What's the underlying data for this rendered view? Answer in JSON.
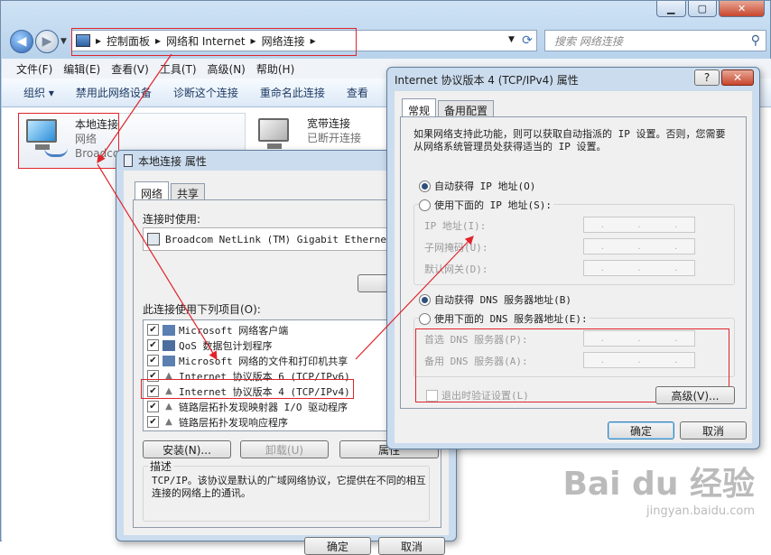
{
  "explorer": {
    "breadcrumb": [
      "控制面板",
      "网络和 Internet",
      "网络连接"
    ],
    "search_placeholder": "搜索 网络连接",
    "menu": [
      "文件(F)",
      "编辑(E)",
      "查看(V)",
      "工具(T)",
      "高级(N)",
      "帮助(H)"
    ],
    "toolbar": [
      "组织 ▾",
      "禁用此网络设备",
      "诊断这个连接",
      "重命名此连接",
      "查看"
    ],
    "connections": [
      {
        "name": "本地连接",
        "status": "网络",
        "device": "Broadcom"
      },
      {
        "name": "宽带连接",
        "status": "已断开连接",
        "device": ""
      }
    ]
  },
  "props_dialog": {
    "title": "本地连接 属性",
    "tabs": [
      "网络",
      "共享"
    ],
    "connect_using_label": "连接时使用:",
    "adapter": "Broadcom NetLink (TM) Gigabit Ethernet",
    "configure_btn": "配置",
    "items_label": "此连接使用下列项目(O):",
    "items": [
      {
        "label": "Microsoft 网络客户端",
        "checked": true,
        "icon": "network-client-icon"
      },
      {
        "label": "QoS 数据包计划程序",
        "checked": true,
        "icon": "qos-icon"
      },
      {
        "label": "Microsoft 网络的文件和打印机共享",
        "checked": true,
        "icon": "file-share-icon"
      },
      {
        "label": "Internet 协议版本 6 (TCP/IPv6)",
        "checked": true,
        "icon": "protocol-icon"
      },
      {
        "label": "Internet 协议版本 4 (TCP/IPv4)",
        "checked": true,
        "icon": "protocol-icon"
      },
      {
        "label": "链路层拓扑发现映射器 I/O 驱动程序",
        "checked": true,
        "icon": "protocol-icon"
      },
      {
        "label": "链路层拓扑发现响应程序",
        "checked": true,
        "icon": "protocol-icon"
      }
    ],
    "install_btn": "安装(N)...",
    "uninstall_btn": "卸载(U)",
    "properties_btn": "属性",
    "desc_label": "描述",
    "desc_text": "TCP/IP。该协议是默认的广域网络协议，它提供在不同的相互连接的网络上的通讯。",
    "ok_btn": "确定",
    "cancel_btn": "取消"
  },
  "ipv4_dialog": {
    "title": "Internet 协议版本 4 (TCP/IPv4) 属性",
    "help": "?",
    "tabs": [
      "常规",
      "备用配置"
    ],
    "intro": "如果网络支持此功能，则可以获取自动指派的 IP 设置。否则，您需要从网络系统管理员处获得适当的 IP 设置。",
    "auto_ip": "自动获得 IP 地址(O)",
    "manual_ip": "使用下面的 IP 地址(S):",
    "ip_label": "IP 地址(I):",
    "mask_label": "子网掩码(U):",
    "gateway_label": "默认网关(D):",
    "auto_dns": "自动获得 DNS 服务器地址(B)",
    "manual_dns": "使用下面的 DNS 服务器地址(E):",
    "pref_dns_label": "首选 DNS 服务器(P):",
    "alt_dns_label": "备用 DNS 服务器(A):",
    "validate": "退出时验证设置(L)",
    "advanced_btn": "高级(V)...",
    "ok_btn": "确定",
    "cancel_btn": "取消"
  },
  "watermark": {
    "brand": "Bai du 经验",
    "url": "jingyan.baidu.com"
  },
  "colors": {
    "annotation_red": "#e0242a",
    "accent_blue": "#2e64b4"
  }
}
